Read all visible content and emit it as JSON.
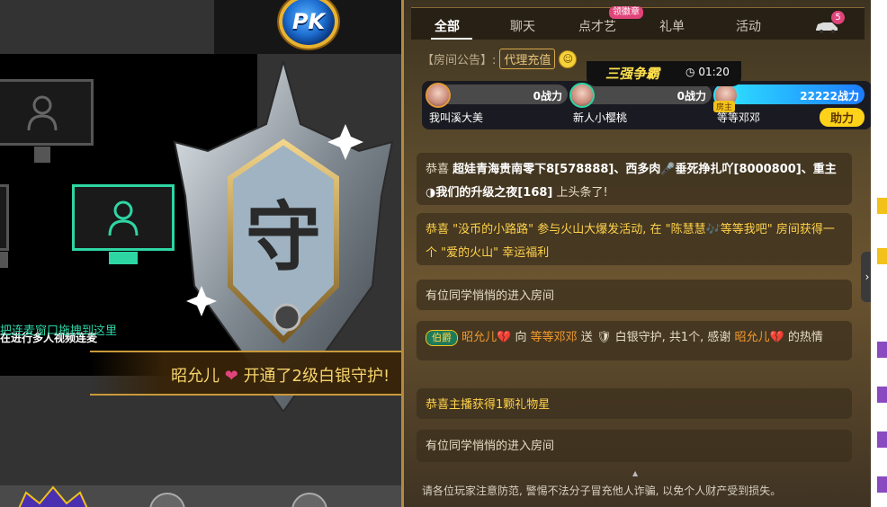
{
  "pk": {
    "label": "PK"
  },
  "video": {
    "tip": "在进行多人视频连麦",
    "drag_tip": "把连麦窗口拖拽到这里"
  },
  "emblem": {
    "char": "守"
  },
  "notify": {
    "name": "昭允儿",
    "text": "开通了2级白银守护!"
  },
  "tabs": [
    {
      "label": "全部"
    },
    {
      "label": "聊天"
    },
    {
      "label": "点才艺"
    },
    {
      "label": "礼单"
    },
    {
      "label": "活动"
    }
  ],
  "tab_badge": "领徽章",
  "car_count": "5",
  "announce": {
    "label": "【房间公告】:",
    "button": "代理充值"
  },
  "battle": {
    "title": "三强争霸",
    "timer": "01:20",
    "players": [
      {
        "name": "我叫溪大美",
        "score": "0战力"
      },
      {
        "name": "新人小樱桃",
        "score": "0战力"
      },
      {
        "name": "等等邓邓",
        "score": "22222战力",
        "tag": "房主"
      }
    ],
    "help": "助力"
  },
  "messages": {
    "m1": {
      "prefix": "恭喜",
      "body": "超娃青海贵南零下8[578888]、西多肉🎤垂死挣扎吖[8000800]、重主◑我们的升级之夜[168]",
      "suffix": "上头条了!"
    },
    "m2": {
      "prefix": "恭喜",
      "body": "\"没币的小路路\" 参与火山大爆发活动, 在 \"陈慧慧🎶等等我吧\" 房间获得一个 \"爱的火山\" 幸运福利"
    },
    "m3": {
      "text": "有位同学悄悄的进入房间"
    },
    "m4": {
      "badge": "伯爵",
      "name": "昭允儿💔",
      "to": "向",
      "host": "等等邓邓",
      "send": "送",
      "gift": "白银守护, 共1个, 感谢",
      "name2": "昭允儿💔",
      "tail": "的热情"
    },
    "m5": {
      "text": "恭喜主播获得1颗礼物星"
    },
    "m6": {
      "text": "有位同学悄悄的进入房间"
    }
  },
  "notice": "请各位玩家注意防范, 警惕不法分子冒充他人诈骗, 以免个人财产受到损失。",
  "colors": {
    "accent_gold": "#ffd24a",
    "video_active": "#2ed6a4",
    "badge_pink": "#e0447a"
  }
}
